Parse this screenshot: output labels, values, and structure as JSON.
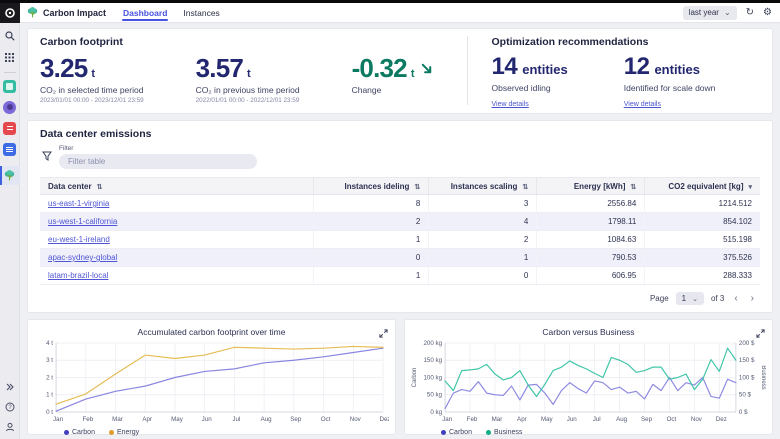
{
  "topbar": {
    "app_name": "Carbon Impact",
    "tabs": [
      {
        "label": "Dashboard",
        "active": true
      },
      {
        "label": "Instances",
        "active": false
      }
    ],
    "time_range": "last year"
  },
  "icons": {
    "refresh": "↻",
    "settings": "⚙",
    "chevron_down": "⌄",
    "sort": "⇅",
    "sort_desc": "▾",
    "prev": "‹",
    "next": "›",
    "expand_more": "»",
    "help": "?"
  },
  "colors": {
    "accent_indigo": "#4652e0",
    "kpi_navy": "#23276f",
    "change_green": "#0c7a60",
    "link": "#4f55d4"
  },
  "carbon_footprint": {
    "title": "Carbon footprint",
    "kpis": [
      {
        "value": "3.25",
        "unit": "t",
        "label": "CO₂ in selected time period",
        "period": "2023/01/01 00:00 - 2023/12/01 23:59"
      },
      {
        "value": "3.57",
        "unit": "t",
        "label": "CO₂ in previous time period",
        "period": "2022/01/01 00:00 - 2022/12/01 23:59"
      },
      {
        "value": "-0.32",
        "unit": "t",
        "label": "Change",
        "trend": "down"
      }
    ]
  },
  "optimization": {
    "title": "Optimization recommendations",
    "cards": [
      {
        "value": "14",
        "unit": "entities",
        "label": "Observed idling",
        "link": "View details"
      },
      {
        "value": "12",
        "unit": "entities",
        "label": "Identified for scale down",
        "link": "View details"
      }
    ]
  },
  "emissions_table": {
    "title": "Data center emissions",
    "filter_label": "Filter",
    "filter_placeholder": "Filter table",
    "columns": [
      {
        "label": "Data center",
        "sort": "both"
      },
      {
        "label": "Instances ideling",
        "sort": "both"
      },
      {
        "label": "Instances scaling",
        "sort": "both"
      },
      {
        "label": "Energy [kWh]",
        "sort": "both"
      },
      {
        "label": "CO2 equivalent [kg]",
        "sort": "desc"
      }
    ],
    "rows": [
      {
        "data_center": "us-east-1-virginia",
        "idling": "8",
        "scaling": "3",
        "energy": "2556.84",
        "co2": "1214.512"
      },
      {
        "data_center": "us-west-1-california",
        "idling": "2",
        "scaling": "4",
        "energy": "1798.11",
        "co2": "854.102"
      },
      {
        "data_center": "eu-west-1-ireland",
        "idling": "1",
        "scaling": "2",
        "energy": "1084.63",
        "co2": "515.198"
      },
      {
        "data_center": "apac-sydney-global",
        "idling": "0",
        "scaling": "1",
        "energy": "790.53",
        "co2": "375.526"
      },
      {
        "data_center": "latam-brazil-local",
        "idling": "1",
        "scaling": "0",
        "energy": "606.95",
        "co2": "288.333"
      }
    ],
    "pagination": {
      "page_label": "Page",
      "current": "1",
      "of_label": "of 3"
    }
  },
  "chart_data": [
    {
      "type": "line",
      "title": "Accumulated carbon footprint over time",
      "x_labels": [
        "Jan",
        "Feb",
        "Mar",
        "Apr",
        "May",
        "Jun",
        "Jul",
        "Aug",
        "Sep",
        "Oct",
        "Nov",
        "Dez"
      ],
      "ylim": [
        0,
        4
      ],
      "ytick_step": 1,
      "left_unit": "t",
      "legend_position": "bottom",
      "grid": true,
      "series": [
        {
          "name": "Carbon",
          "color": "#8a86e0",
          "dot": "#4340c0",
          "values": [
            0.05,
            0.75,
            1.2,
            1.5,
            2.0,
            2.35,
            2.5,
            2.85,
            3.0,
            3.2,
            3.45,
            3.7
          ]
        },
        {
          "name": "Energy",
          "color": "#e5bd55",
          "dot": "#e09b2d",
          "values": [
            0.45,
            1.05,
            2.2,
            3.3,
            3.1,
            3.3,
            3.75,
            3.7,
            3.65,
            3.7,
            3.8,
            3.75
          ]
        }
      ]
    },
    {
      "type": "line",
      "title": "Carbon versus Business",
      "x_labels": [
        "Jan",
        "Feb",
        "Mar",
        "Apr",
        "May",
        "Jun",
        "Jul",
        "Aug",
        "Sep",
        "Oct",
        "Nov",
        "Dez"
      ],
      "points_per_tick": 3,
      "ylim": [
        0,
        200
      ],
      "ytick_step": 50,
      "left_unit": "kg",
      "right_unit": "$",
      "left_axis_title": "Carbon",
      "right_axis_title": "Business",
      "legend_position": "bottom",
      "grid": true,
      "series": [
        {
          "name": "Carbon",
          "color": "#8f8be2",
          "dot": "#4340c0",
          "axis": "left",
          "values": [
            10,
            55,
            65,
            60,
            88,
            55,
            50,
            48,
            75,
            35,
            78,
            80,
            55,
            22,
            62,
            85,
            68,
            55,
            90,
            85,
            65,
            72,
            55,
            60,
            38,
            80,
            62,
            100,
            62,
            85,
            78,
            100,
            45,
            40,
            95,
            85
          ]
        },
        {
          "name": "Business",
          "color": "#41c6a8",
          "dot": "#0fae85",
          "axis": "right",
          "values": [
            90,
            62,
            120,
            122,
            125,
            138,
            110,
            93,
            100,
            120,
            78,
            45,
            80,
            120,
            130,
            148,
            135,
            125,
            112,
            100,
            158,
            150,
            138,
            115,
            120,
            130,
            130,
            95,
            100,
            110,
            65,
            95,
            152,
            118,
            185,
            150
          ]
        }
      ]
    }
  ]
}
